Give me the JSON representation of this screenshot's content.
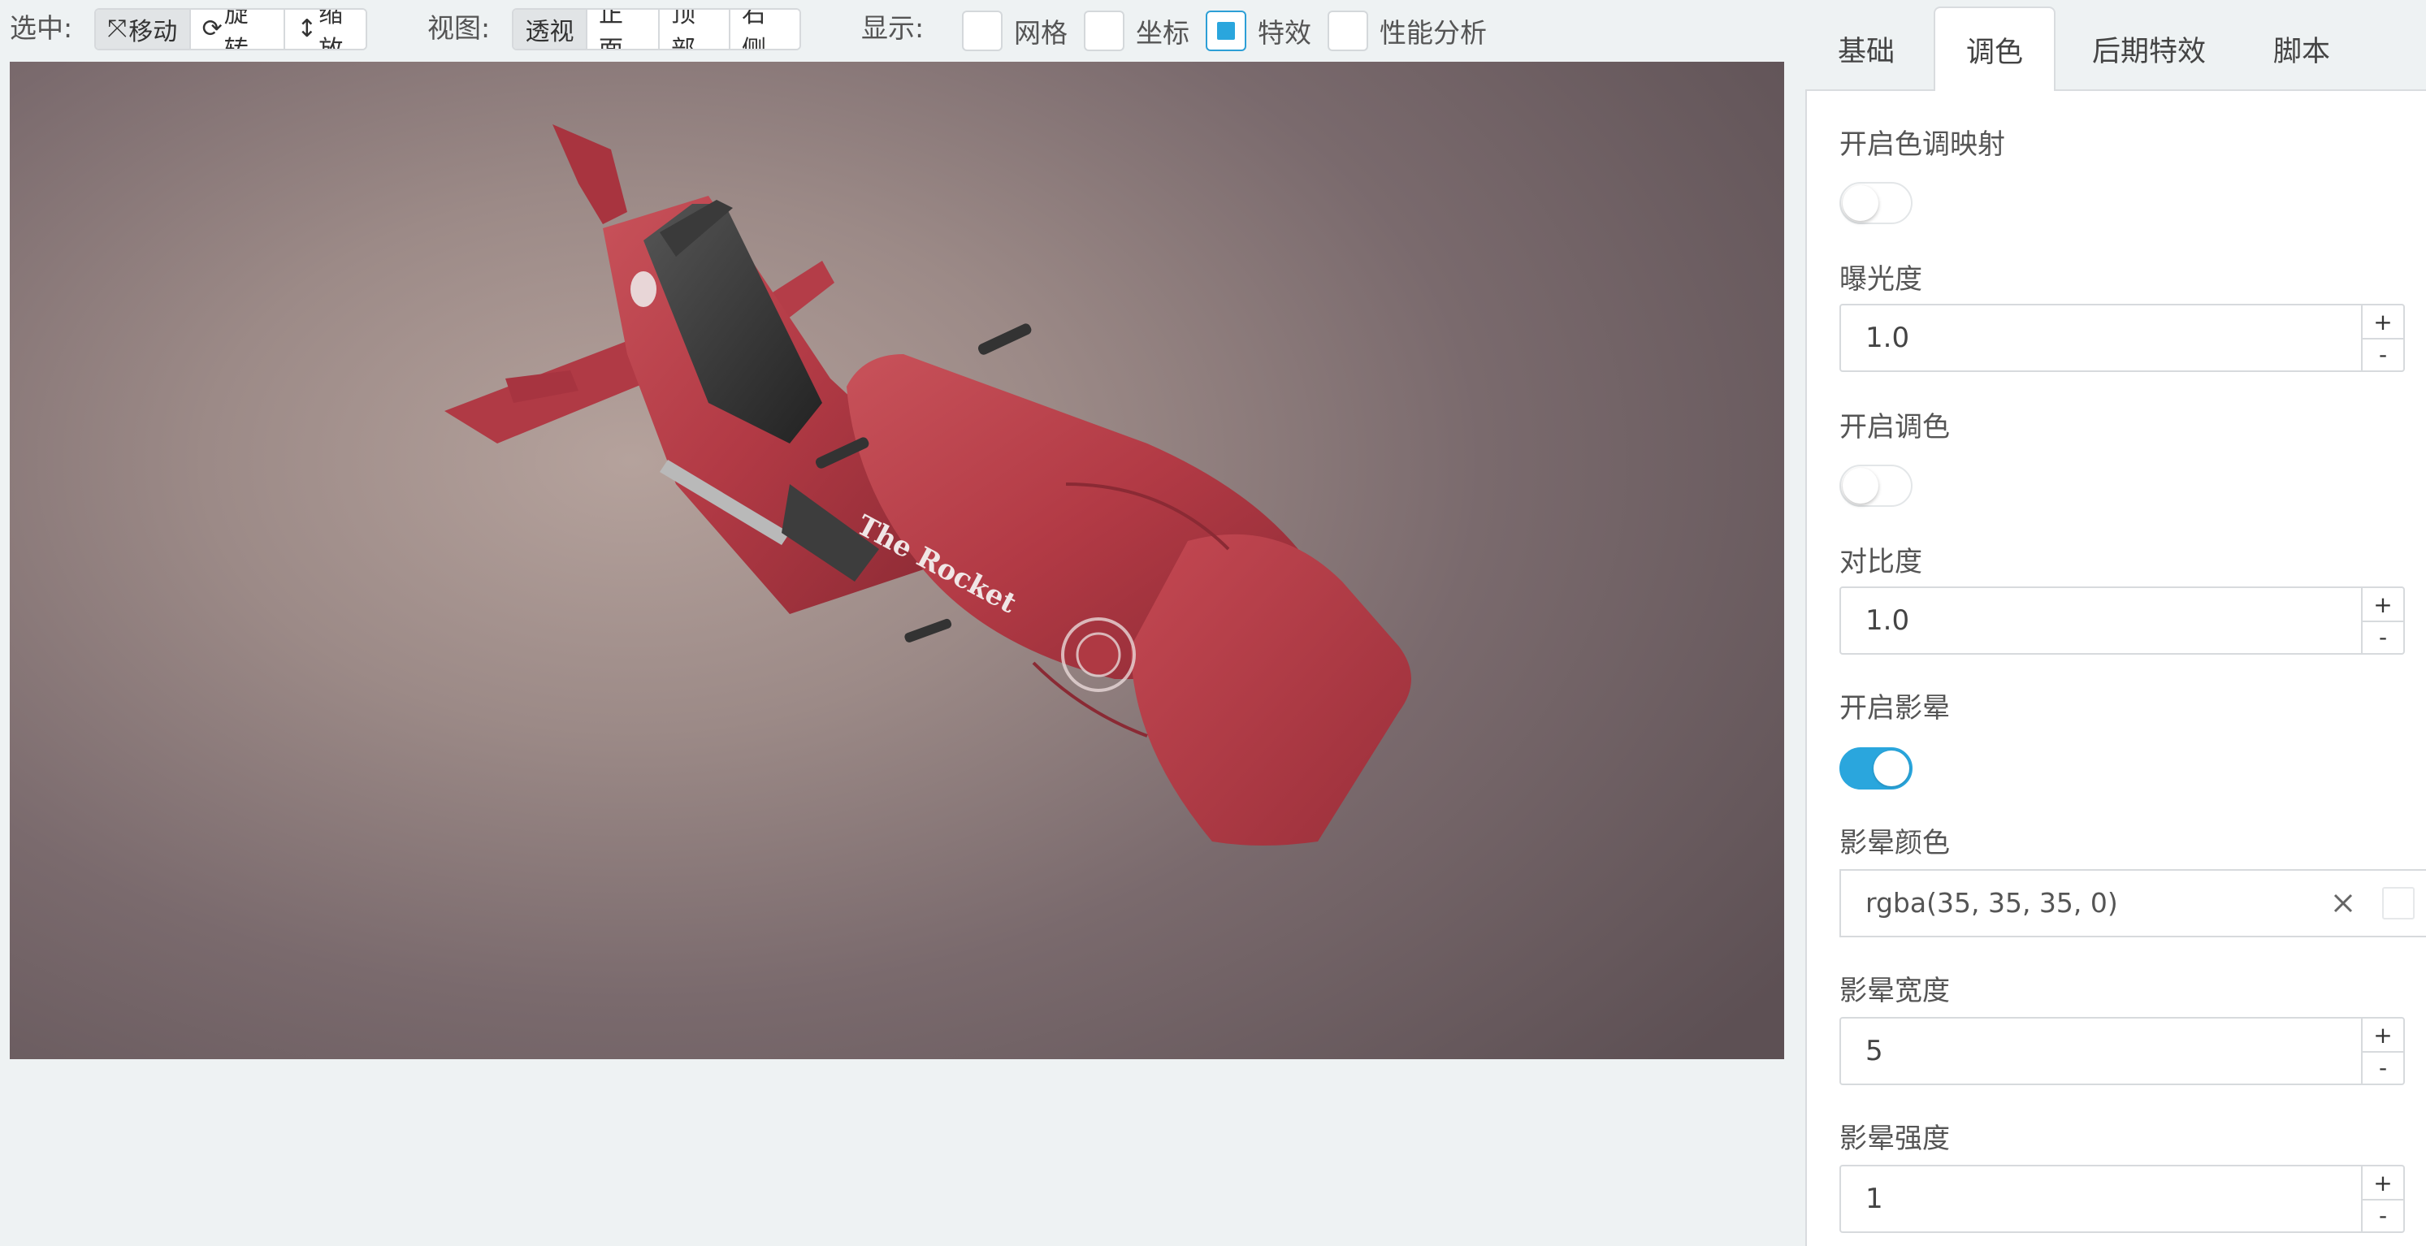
{
  "toolbar": {
    "select": {
      "label": "选中:",
      "buttons": [
        {
          "icon": "move-icon",
          "label": "移动",
          "active": true
        },
        {
          "icon": "rotate-icon",
          "label": "旋转",
          "active": false
        },
        {
          "icon": "scale-icon",
          "label": "缩放",
          "active": false
        }
      ]
    },
    "view": {
      "label": "视图:",
      "buttons": [
        {
          "label": "透视",
          "active": true
        },
        {
          "label": "正面",
          "active": false
        },
        {
          "label": "顶部",
          "active": false
        },
        {
          "label": "右侧",
          "active": false
        }
      ]
    },
    "display": {
      "label": "显示:",
      "options": [
        {
          "label": "网格",
          "checked": false
        },
        {
          "label": "坐标",
          "checked": false
        },
        {
          "label": "特效",
          "checked": true
        },
        {
          "label": "性能分析",
          "checked": false
        }
      ]
    }
  },
  "viewport": {
    "decal_text": "The Rocket"
  },
  "panel": {
    "tabs": [
      {
        "label": "基础",
        "active": false
      },
      {
        "label": "调色",
        "active": true
      },
      {
        "label": "后期特效",
        "active": false
      },
      {
        "label": "脚本",
        "active": false
      }
    ],
    "tone_mapping": {
      "label": "开启色调映射",
      "on": false
    },
    "exposure": {
      "label": "曝光度",
      "value": "1.0"
    },
    "color_grading": {
      "label": "开启调色",
      "on": false
    },
    "contrast": {
      "label": "对比度",
      "value": "1.0"
    },
    "vignette": {
      "label": "开启影晕",
      "on": true
    },
    "vignette_color": {
      "label": "影晕颜色",
      "value": "rgba(35, 35, 35, 0)"
    },
    "vignette_width": {
      "label": "影晕宽度",
      "value": "5"
    },
    "vignette_intensity": {
      "label": "影晕强度",
      "value": "1"
    },
    "stepper": {
      "plus": "+",
      "minus": "-"
    },
    "colors": {
      "accent": "#2aa6dd",
      "rocket_red": "#b83a44"
    }
  }
}
